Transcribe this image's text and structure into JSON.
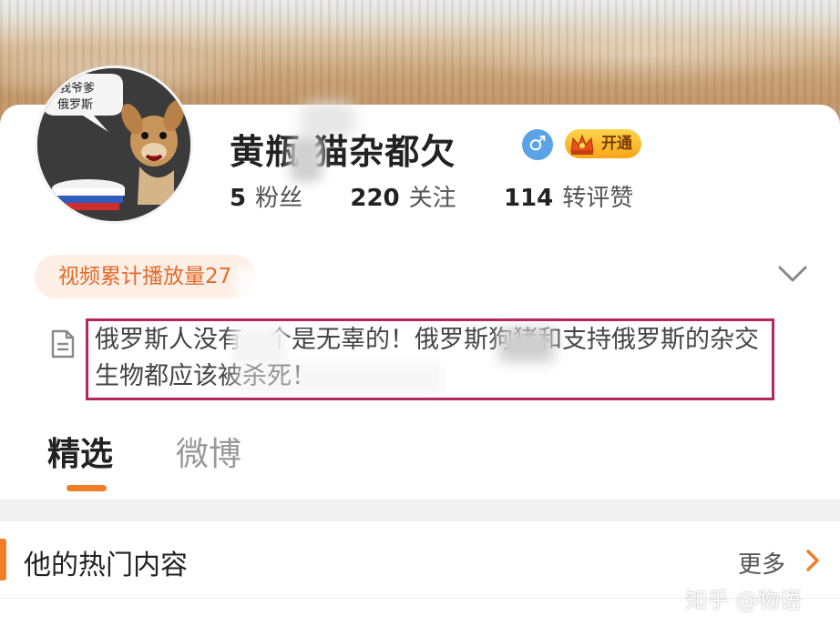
{
  "profile": {
    "name": "黄瓶 猫杂都欠",
    "gender_symbol": "♂",
    "vip_label": "开通",
    "avatar_bubble_line1": "我爷爹",
    "avatar_bubble_line2": "俄罗斯"
  },
  "stats": [
    {
      "value": "5",
      "label": "粉丝"
    },
    {
      "value": "220",
      "label": "关注"
    },
    {
      "value": "114",
      "label": "转评赞"
    }
  ],
  "video_pill": "视频累计播放量27",
  "bio": "俄罗斯人没有一个是无辜的！俄罗斯狗猪和支持俄罗斯的杂交生物都应该被杀死！",
  "tabs": {
    "active": "精选",
    "inactive": "微博"
  },
  "section": {
    "title": "他的热门内容",
    "more": "更多"
  },
  "watermark": "知乎 @物语",
  "colors": {
    "accent": "#f07e26",
    "highlight_border": "#b5265c",
    "pill_bg": "#fdeee6"
  }
}
